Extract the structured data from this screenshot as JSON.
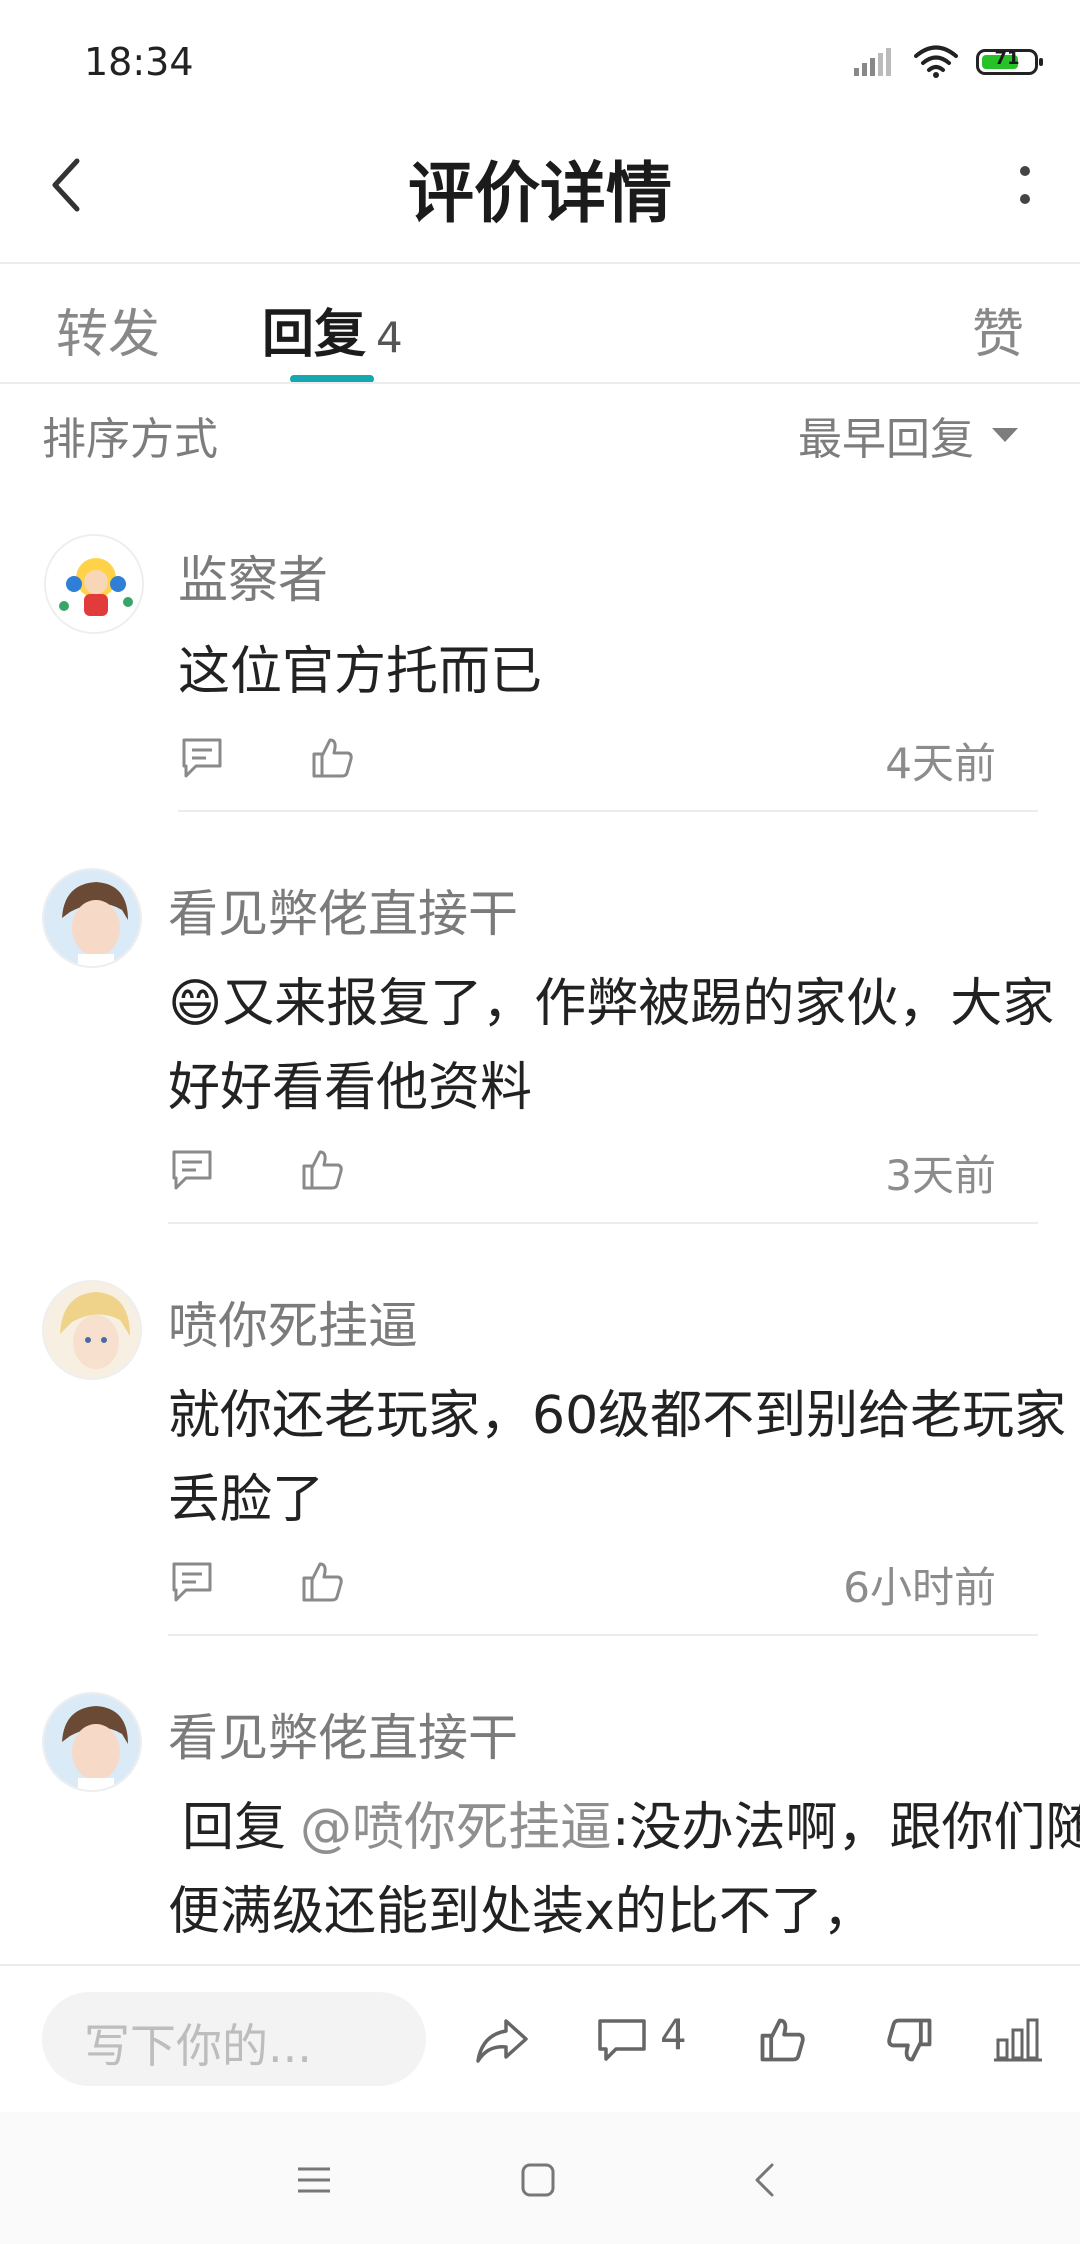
{
  "status_bar": {
    "time": "18:34",
    "battery": "71",
    "battery_fraction": 0.71
  },
  "header": {
    "title": "评价详情"
  },
  "tabs": [
    {
      "label": "转发"
    },
    {
      "label": "回复",
      "count": "4",
      "active": true
    },
    {
      "label": "赞"
    }
  ],
  "sort": {
    "label": "排序方式",
    "value": "最早回复"
  },
  "comments": [
    {
      "user": "监察者",
      "text": "这位官方托而已",
      "time": "4天前"
    },
    {
      "user": "看见弊佬直接干",
      "emoji": "😄",
      "text": "又来报复了，作弊被踢的家伙，大家好好看看他资料",
      "time": "3天前"
    },
    {
      "user": "喷你死挂逼",
      "text": "就你还老玩家，60级都不到别给老玩家丢脸了",
      "time": "6小时前"
    },
    {
      "user": "看见弊佬直接干",
      "reply_prefix": "回复",
      "mention": "@喷你死挂逼",
      "text": ":没办法啊，跟你们随便满级还能到处装x的比不了，"
    }
  ],
  "bottom_bar": {
    "compose_placeholder": "写下你的...",
    "comment_count": "4"
  },
  "colors": {
    "accent": "#17a7b0",
    "text": "#222222",
    "muted": "#7b7b7b"
  },
  "icons": {
    "back": "chevron-left-icon",
    "more": "more-vertical-icon",
    "reply": "comment-icon",
    "like": "thumbs-up-icon",
    "share": "share-icon",
    "dislike": "thumbs-down-icon",
    "stats": "bar-chart-icon"
  }
}
